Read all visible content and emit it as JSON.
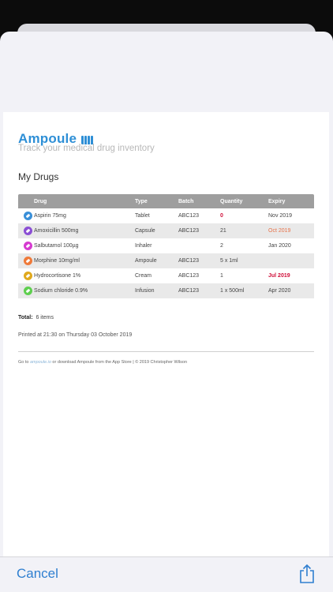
{
  "document": {
    "brand": "Ampoule",
    "tagline": "Track your medical drug inventory",
    "section_title": "My Drugs",
    "columns": [
      "Drug",
      "Type",
      "Batch",
      "Quantity",
      "Expiry"
    ],
    "rows": [
      {
        "icon": "tablet-icon",
        "color": "#3a8fd8",
        "drug": "Aspirin 75mg",
        "type": "Tablet",
        "batch": "ABC123",
        "quantity": "0",
        "quantity_status": "red",
        "expiry": "Nov 2019",
        "expiry_status": ""
      },
      {
        "icon": "capsule-icon",
        "color": "#8b4fd4",
        "drug": "Amoxicillin 500mg",
        "type": "Capsule",
        "batch": "ABC123",
        "quantity": "21",
        "quantity_status": "",
        "expiry": "Oct 2019",
        "expiry_status": "orange"
      },
      {
        "icon": "inhaler-icon",
        "color": "#d63bd0",
        "drug": "Salbutamol 100µg",
        "type": "Inhaler",
        "batch": "",
        "quantity": "2",
        "quantity_status": "",
        "expiry": "Jan 2020",
        "expiry_status": ""
      },
      {
        "icon": "ampoule-icon",
        "color": "#ef7a3a",
        "drug": "Morphine 10mg/ml",
        "type": "Ampoule",
        "batch": "ABC123",
        "quantity": "5 x 1ml",
        "quantity_status": "",
        "expiry": "",
        "expiry_status": ""
      },
      {
        "icon": "cream-icon",
        "color": "#e0a91e",
        "drug": "Hydrocortisone 1%",
        "type": "Cream",
        "batch": "ABC123",
        "quantity": "1",
        "quantity_status": "",
        "expiry": "Jul 2019",
        "expiry_status": "red"
      },
      {
        "icon": "infusion-icon",
        "color": "#5fcf4f",
        "drug": "Sodium chloride 0.9%",
        "type": "Infusion",
        "batch": "ABC123",
        "quantity": "1 x 500ml",
        "quantity_status": "",
        "expiry": "Apr 2020",
        "expiry_status": ""
      }
    ],
    "total_label": "Total:",
    "total_value": "6 items",
    "printed": "Printed at 21:30 on Thursday 03 October 2019",
    "footer_prefix": "Go to ",
    "footer_link": "ampoule.io",
    "footer_suffix": " or download Ampoule from the App Store | © 2019 Christopher Wilson"
  },
  "toolbar": {
    "cancel_label": "Cancel",
    "share_icon": "share-icon"
  },
  "colors": {
    "accent": "#2e8fd6",
    "warning_red": "#d0103a",
    "warning_orange": "#e8734a",
    "header_gray": "#9e9e9e"
  }
}
